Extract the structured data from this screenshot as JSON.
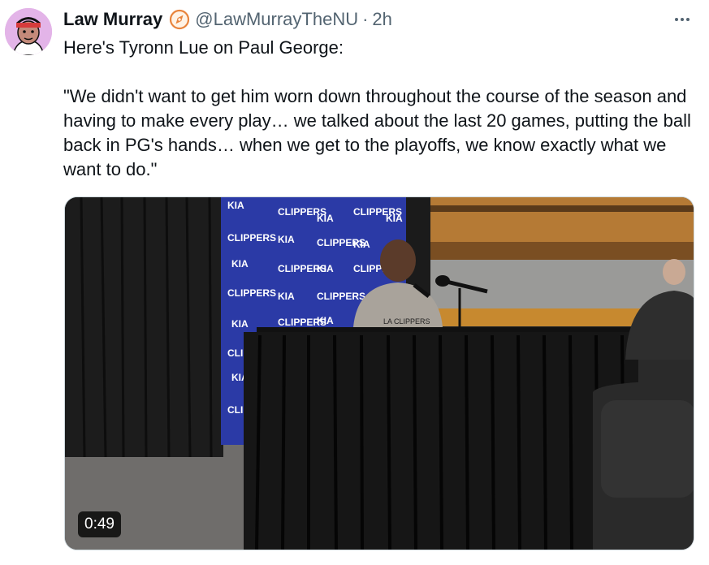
{
  "tweet": {
    "author_name": "Law Murray",
    "handle": "@LawMurrayTheNU",
    "separator": "·",
    "time": "2h",
    "text_intro": "Here's Tyronn Lue on Paul George:",
    "text_quote": "\"We didn't want to get him worn down throughout the course of the season and having to make every play… we talked about the last 20 games, putting the ball back in PG's hands… when we get to the playoffs, we know exactly what we want to do.\""
  },
  "media": {
    "type": "video",
    "duration": "0:49",
    "backdrop_brand_text": "KIA",
    "backdrop_team_text": "CLIPPERS",
    "shirt_text": "LA CLIPPERS"
  },
  "icons": {
    "more": "more-horizontal-icon",
    "badge": "compass-badge-icon"
  },
  "colors": {
    "text": "#0f1419",
    "secondary": "#536471",
    "backdrop_blue": "#2b3aa6",
    "avatar_bg": "#e3b4e8",
    "badge_orange": "#e8843c"
  }
}
